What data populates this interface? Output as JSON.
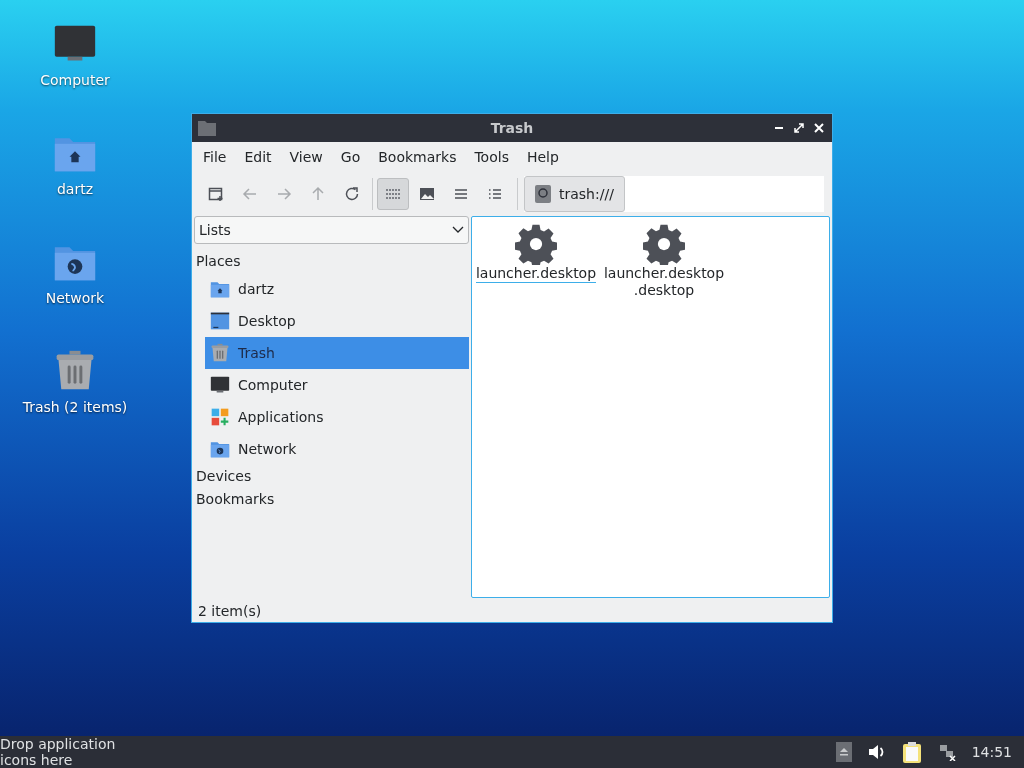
{
  "desktop_icons": [
    {
      "label": "Computer",
      "kind": "computer"
    },
    {
      "label": "dartz",
      "kind": "home"
    },
    {
      "label": "Network",
      "kind": "network"
    },
    {
      "label": "Trash (2 items)",
      "kind": "trash"
    }
  ],
  "window": {
    "title": "Trash"
  },
  "menu": [
    "File",
    "Edit",
    "View",
    "Go",
    "Bookmarks",
    "Tools",
    "Help"
  ],
  "toolbar": {
    "nav": [
      {
        "kind": "new-tab",
        "disabled": false
      },
      {
        "kind": "back",
        "disabled": true
      },
      {
        "kind": "forward",
        "disabled": true
      },
      {
        "kind": "up",
        "disabled": true
      },
      {
        "kind": "reload",
        "disabled": false
      }
    ],
    "views": [
      {
        "kind": "icons",
        "selected": true
      },
      {
        "kind": "thumbnails",
        "selected": false
      },
      {
        "kind": "compact",
        "selected": false
      },
      {
        "kind": "details",
        "selected": false
      }
    ],
    "location": "trash:///"
  },
  "sidebar": {
    "mode": "Lists",
    "sections": [
      {
        "title": "Places",
        "items": [
          {
            "label": "dartz",
            "kind": "home",
            "selected": false
          },
          {
            "label": "Desktop",
            "kind": "desktop",
            "selected": false
          },
          {
            "label": "Trash",
            "kind": "trash",
            "selected": true
          },
          {
            "label": "Computer",
            "kind": "computer",
            "selected": false
          },
          {
            "label": "Applications",
            "kind": "apps",
            "selected": false
          },
          {
            "label": "Network",
            "kind": "network",
            "selected": false
          }
        ]
      },
      {
        "title": "Devices"
      },
      {
        "title": "Bookmarks"
      }
    ]
  },
  "files": [
    {
      "name": "launcher.desktop",
      "selected": true
    },
    {
      "name": "launcher.desktop .desktop",
      "selected": false
    }
  ],
  "status_bar": "2 item(s)",
  "taskbar": {
    "drop_hint": "Drop application icons here",
    "clock": "14:51"
  }
}
